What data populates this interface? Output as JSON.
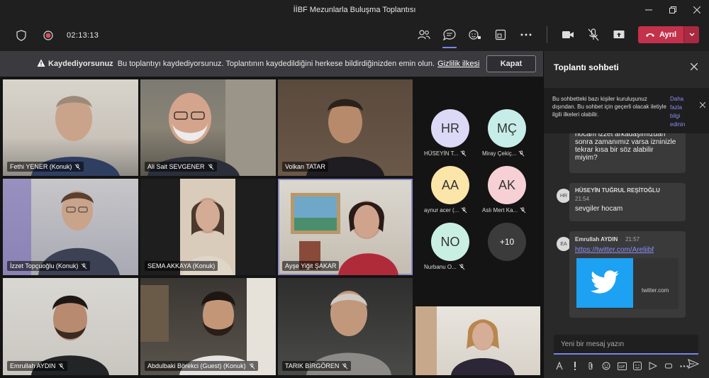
{
  "window": {
    "title": "İİBF Mezunlarla Buluşma Toplantısı"
  },
  "toolbar": {
    "timer": "02:13:13",
    "leave_label": "Ayrıl"
  },
  "banner": {
    "title": "Kaydediyorsunuz",
    "text": "Bu toplantıyı kaydediyorsunuz. Toplantının kaydedildiğini herkese bildirdiğinizden emin olun.",
    "link": "Gizlilik ilkesi",
    "close_label": "Kapat"
  },
  "participants": [
    {
      "name": "Fethi YENER (Konuk)",
      "muted": true
    },
    {
      "name": "Ali Sait SEVGENER",
      "muted": true
    },
    {
      "name": "Volkan TATAR",
      "muted": false
    },
    {
      "name": "İzzet Topçuoğlu (Konuk)",
      "muted": true
    },
    {
      "name": "SEMA AKKAYA (Konuk)",
      "muted": false
    },
    {
      "name": "Ayşe Yiğit ŞAKAR",
      "muted": false
    },
    {
      "name": "Emrullah AYDIN",
      "muted": true
    },
    {
      "name": "Abdulbaki Börekci (Guest) (Konuk)",
      "muted": true
    },
    {
      "name": "TARIK BİRGÖREN",
      "muted": true
    }
  ],
  "avatars": [
    {
      "initials": "HR",
      "label": "HÜSEYİN T...",
      "color": "#dbd9f5"
    },
    {
      "initials": "MÇ",
      "label": "Miray Çekiç...",
      "color": "#c7ede8"
    },
    {
      "initials": "AA",
      "label": "aynur acer (...",
      "color": "#fbe5a8"
    },
    {
      "initials": "AK",
      "label": "Aslı Mert Ka...",
      "color": "#f6d0d4"
    },
    {
      "initials": "NO",
      "label": "Nurbanu O...",
      "color": "#c9efe2"
    },
    {
      "initials": "+10",
      "label": "",
      "color": "#3b3b3b"
    }
  ],
  "chat": {
    "title": "Toplantı sohbeti",
    "notice": "Bu sohbetteki bazı kişiler kuruluşunuz dışından. Bu sohbet için geçerli olacak iletiyle ilgili ilkeleri olabilir.",
    "notice_more": "Daha fazla bilgi edinin",
    "messages": [
      {
        "text_lines": [
          "hocam izzet arkadaşımızdan",
          "sonra zamanımız varsa izninizle",
          "tekrar kısa bir söz alabilir",
          "miyim?"
        ]
      },
      {
        "initials": "HR",
        "sender": "HÜSEYİN TUĞRUL REŞİTOĞLU",
        "time": "21:54",
        "text": "sevgiler hocam"
      },
      {
        "initials": "EA",
        "sender": "Emrullah AYDIN",
        "time": "21:57",
        "link": "https://twitter.com/Areliibf",
        "preview_site": "twitter.com"
      }
    ],
    "compose_placeholder": "Yeni bir mesaj yazın"
  }
}
